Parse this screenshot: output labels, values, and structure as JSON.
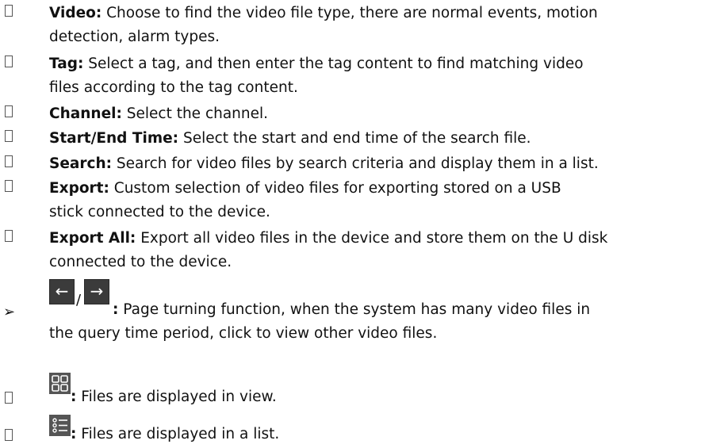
{
  "items": [
    {
      "label": "Video:",
      "text": "Choose to find the video file type, there are normal events, motion",
      "cont": "detection, alarm types."
    },
    {
      "label": "Tag:",
      "text": "Select a tag, and then enter the tag content to find matching video",
      "cont": "files according to the tag content."
    },
    {
      "label": "Channel:",
      "text": "Select the channel."
    },
    {
      "label": "Start/End Time:",
      "text": "Select the start and end time of the search file."
    },
    {
      "label": "Search:",
      "text": "Search for video files by search criteria and display them in a list."
    },
    {
      "label": "Export:",
      "text": "Custom selection of video files for exporting stored on a USB",
      "cont": "stick connected to the device."
    },
    {
      "label": "Export All:",
      "text": "Export all video files in the device and store them on the U disk",
      "cont": "connected to the device."
    }
  ],
  "page_turn": {
    "left_glyph": "←",
    "separator": "/",
    "right_glyph": "→",
    "colon": ":",
    "text": "Page turning function, when the system has many video files in",
    "cont": "the query time period, click to view other video files."
  },
  "view_mode": {
    "colon": ":",
    "text": "Files are displayed in view."
  },
  "list_mode": {
    "colon": ":",
    "text": "Files are displayed in a list."
  }
}
